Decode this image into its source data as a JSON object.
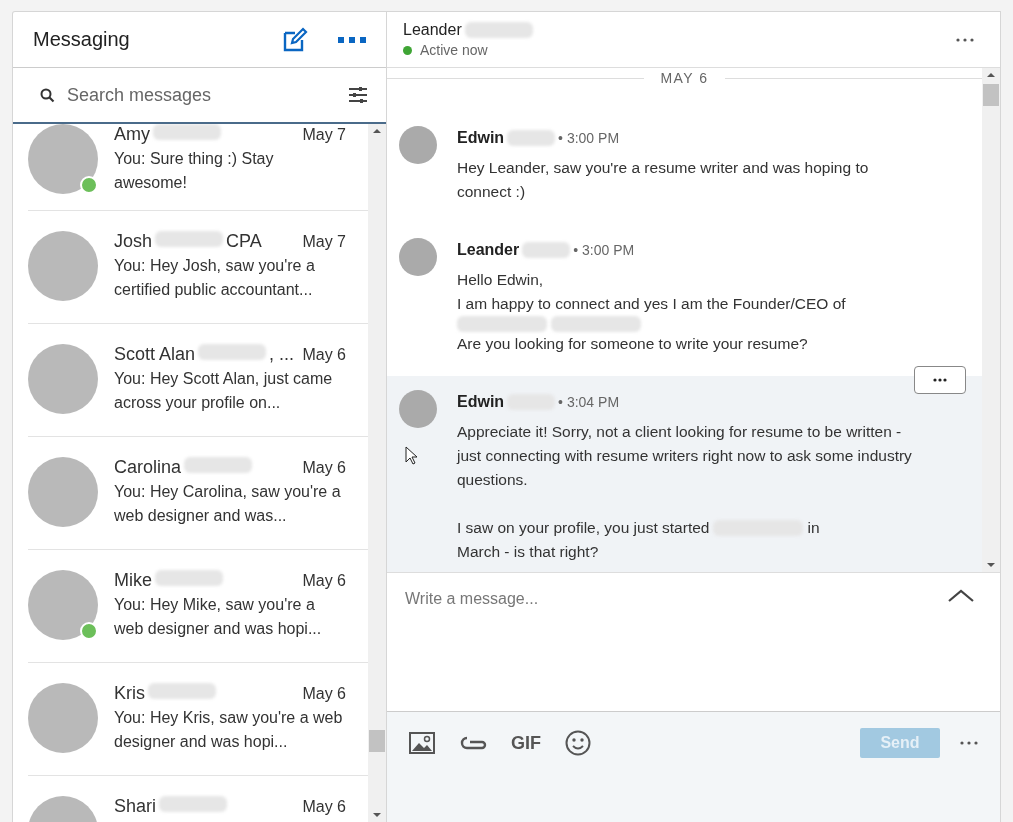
{
  "sidebar": {
    "title": "Messaging",
    "search": {
      "placeholder": "Search messages"
    },
    "conversations": [
      {
        "name": "Amy",
        "date": "May 7",
        "preview": "You: Sure thing :) Stay awesome!",
        "online": true
      },
      {
        "name": "Josh",
        "name_suffix": "CPA",
        "date": "May 7",
        "preview": "You: Hey Josh, saw you're a certified public accountant...",
        "online": false
      },
      {
        "name": "Scott Alan",
        "name_suffix": ", ...",
        "date": "May 6",
        "preview": "You: Hey Scott Alan, just came across your profile on...",
        "online": false
      },
      {
        "name": "Carolina",
        "date": "May 6",
        "preview": "You: Hey Carolina, saw you're a web designer and was...",
        "online": false
      },
      {
        "name": "Mike",
        "date": "May 6",
        "preview": "You: Hey Mike, saw you're a web designer and was hopi...",
        "online": true
      },
      {
        "name": "Kris",
        "date": "May 6",
        "preview": "You: Hey Kris, saw you're a web designer and was hopi...",
        "online": false
      },
      {
        "name": "Shari",
        "date": "May 6"
      }
    ]
  },
  "conversation": {
    "name": "Leander",
    "status": "Active now",
    "online": true,
    "date_divider": "MAY 6",
    "messages": [
      {
        "sender": "Edwin",
        "time": "• 3:00 PM",
        "highlighted": false,
        "paragraphs": [
          [
            {
              "kind": "text",
              "text": "Hey Leander, saw you're a resume writer and was hoping to connect :)"
            }
          ]
        ]
      },
      {
        "sender": "Leander",
        "time": "• 3:00 PM",
        "highlighted": false,
        "paragraphs": [
          [
            {
              "kind": "text",
              "text": "Hello Edwin,"
            }
          ],
          [
            {
              "kind": "text",
              "text": "I am happy to connect and yes I am the Founder/CEO of"
            },
            {
              "kind": "redacted"
            },
            {
              "kind": "redacted"
            }
          ],
          [
            {
              "kind": "text",
              "text": "Are you looking for someone to write your resume?"
            }
          ]
        ]
      },
      {
        "sender": "Edwin",
        "time": "• 3:04 PM",
        "highlighted": true,
        "paragraphs": [
          [
            {
              "kind": "text",
              "text": "Appreciate it! Sorry, not a client looking for resume to be written - just connecting with resume writers right now to ask some industry questions."
            }
          ],
          [
            {
              "kind": "text",
              "text": "I saw on your profile, you just started"
            },
            {
              "kind": "redacted"
            },
            {
              "kind": "text",
              "text": "in"
            },
            {
              "kind": "text",
              "text": "March - is that right?"
            }
          ]
        ]
      }
    ],
    "composer": {
      "placeholder": "Write a message...",
      "send": {
        "label": "Send",
        "disabled": true
      },
      "toolbar": [
        {
          "kind": "image"
        },
        {
          "kind": "attachment"
        },
        {
          "kind": "gif",
          "label": "GIF"
        },
        {
          "kind": "emoji"
        }
      ]
    }
  }
}
